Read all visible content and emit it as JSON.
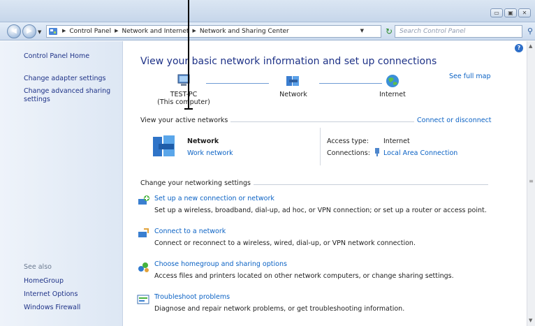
{
  "navbar": {
    "back_icon": "back-arrow-icon",
    "forward_icon": "forward-arrow-icon",
    "breadcrumbs": [
      "Control Panel",
      "Network and Internet",
      "Network and Sharing Center"
    ],
    "search_placeholder": "Search Control Panel"
  },
  "sidebar": {
    "items": [
      {
        "label": "Control Panel Home"
      },
      {
        "label": "Change adapter settings"
      },
      {
        "label": "Change advanced sharing settings"
      }
    ],
    "see_also_label": "See also",
    "see_also": [
      {
        "label": "HomeGroup"
      },
      {
        "label": "Internet Options"
      },
      {
        "label": "Windows Firewall"
      }
    ]
  },
  "main": {
    "heading": "View your basic network information and set up connections",
    "see_full_map": "See full map",
    "map": {
      "computer": "TEST-PC",
      "computer_sub": "(This computer)",
      "network": "Network",
      "internet": "Internet"
    },
    "active_networks_label": "View your active networks",
    "connect_disconnect": "Connect or disconnect",
    "network_name": "Network",
    "network_type": "Work network",
    "access_type_label": "Access type:",
    "access_type_value": "Internet",
    "connections_label": "Connections:",
    "connections_value": "Local Area Connection",
    "settings_label": "Change your networking settings",
    "tasks": [
      {
        "title": "Set up a new connection or network",
        "desc": "Set up a wireless, broadband, dial-up, ad hoc, or VPN connection; or set up a router or access point."
      },
      {
        "title": "Connect to a network",
        "desc": "Connect or reconnect to a wireless, wired, dial-up, or VPN network connection."
      },
      {
        "title": "Choose homegroup and sharing options",
        "desc": "Access files and printers located on other network computers, or change sharing settings."
      },
      {
        "title": "Troubleshoot problems",
        "desc": "Diagnose and repair network problems, or get troubleshooting information."
      }
    ]
  }
}
